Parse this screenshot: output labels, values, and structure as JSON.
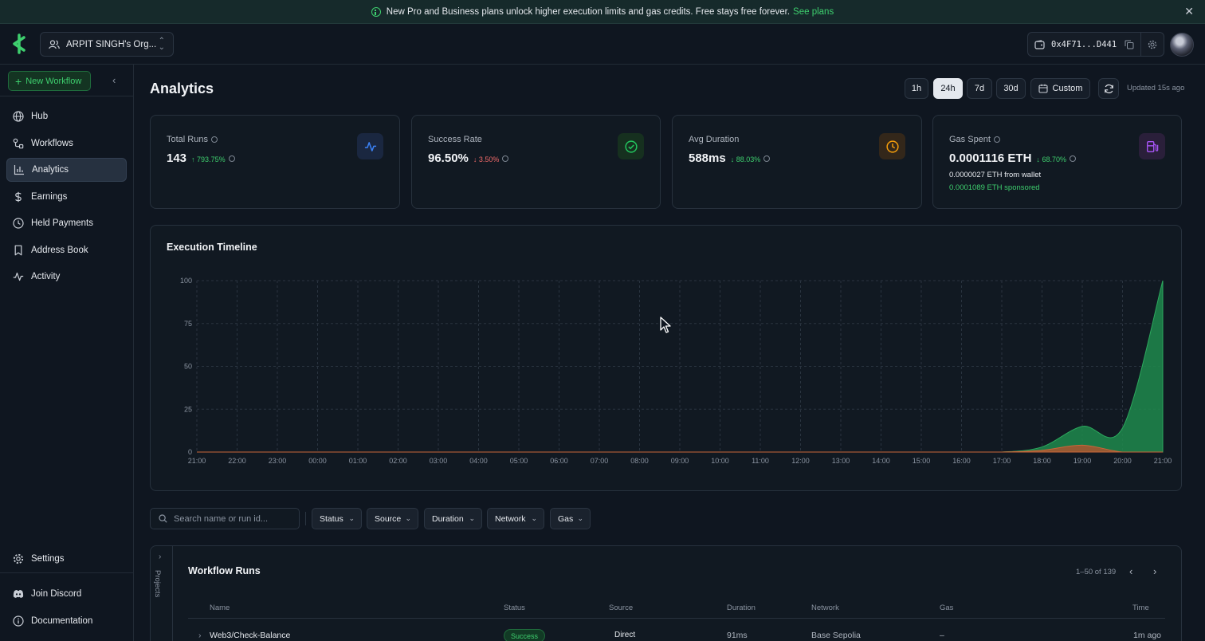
{
  "banner": {
    "message": "New Pro and Business plans unlock higher execution limits and gas credits. Free stays free forever.",
    "link": "See plans",
    "close": "✕"
  },
  "topbar": {
    "org_name": "ARPIT SINGH's Org...",
    "wallet_address": "0x4F71...D441"
  },
  "sidebar": {
    "new_workflow": "New Workflow",
    "items": [
      {
        "label": "Hub",
        "icon": "globe-icon"
      },
      {
        "label": "Workflows",
        "icon": "workflow-icon"
      },
      {
        "label": "Analytics",
        "icon": "bar-chart-icon",
        "active": true
      },
      {
        "label": "Earnings",
        "icon": "dollar-icon"
      },
      {
        "label": "Held Payments",
        "icon": "clock-icon"
      },
      {
        "label": "Address Book",
        "icon": "bookmark-icon"
      },
      {
        "label": "Activity",
        "icon": "activity-icon"
      }
    ],
    "settings": "Settings",
    "discord": "Join Discord",
    "docs": "Documentation"
  },
  "page": {
    "title": "Analytics",
    "ranges": [
      "1h",
      "24h",
      "7d",
      "30d"
    ],
    "active_range": "24h",
    "custom": "Custom",
    "updated": "Updated 15s ago"
  },
  "cards": [
    {
      "label": "Total Runs",
      "value": "143",
      "delta": "793.75%",
      "delta_dir": "up",
      "icon": "activity-icon",
      "accent": "#3b82f6"
    },
    {
      "label": "Success Rate",
      "value": "96.50%",
      "delta": "3.50%",
      "delta_dir": "down",
      "icon": "check-circle-icon",
      "accent": "#22c55e"
    },
    {
      "label": "Avg Duration",
      "value": "588ms",
      "delta": "88.03%",
      "delta_dir": "down",
      "icon": "clock-icon",
      "accent": "#f59e0b"
    },
    {
      "label": "Gas Spent",
      "value": "0.0001116 ETH",
      "delta": "68.70%",
      "delta_dir": "down",
      "icon": "fuel-icon",
      "accent": "#a855f7",
      "sub1": "0.0000027 ETH from wallet",
      "sub2": "0.0001089 ETH sponsored"
    }
  ],
  "timeline": {
    "title": "Execution Timeline"
  },
  "chart_data": {
    "type": "area",
    "x": [
      "21:00",
      "22:00",
      "23:00",
      "00:00",
      "01:00",
      "02:00",
      "03:00",
      "04:00",
      "05:00",
      "06:00",
      "07:00",
      "08:00",
      "09:00",
      "10:00",
      "11:00",
      "12:00",
      "13:00",
      "14:00",
      "15:00",
      "16:00",
      "17:00",
      "18:00",
      "19:00",
      "20:00",
      "21:00"
    ],
    "yticks": [
      0,
      25,
      50,
      75,
      100
    ],
    "ylim": [
      0,
      100
    ],
    "grid": true,
    "series": [
      {
        "color": "#1f8a4c",
        "values": [
          0,
          0,
          0,
          0,
          0,
          0,
          0,
          0,
          0,
          0,
          0,
          0,
          0,
          0,
          0,
          0,
          0,
          0,
          0,
          0,
          0,
          3,
          15,
          14,
          100
        ]
      },
      {
        "color": "#b5522e",
        "values": [
          0,
          0,
          0,
          0,
          0,
          0,
          0,
          0,
          0,
          0,
          0,
          0,
          0,
          0,
          0,
          0,
          0,
          0,
          0,
          0,
          0,
          1,
          4,
          0,
          0
        ]
      }
    ]
  },
  "filters": {
    "search_placeholder": "Search name or run id...",
    "buttons": [
      "Status",
      "Source",
      "Duration",
      "Network",
      "Gas"
    ]
  },
  "runs": {
    "rail_label": "Projects",
    "title": "Workflow Runs",
    "pagination": "1–50 of 139",
    "columns": [
      "Name",
      "Status",
      "Source",
      "Duration",
      "Network",
      "Gas",
      "Time"
    ],
    "rows": [
      {
        "name": "Web3/Check-Balance",
        "status": "Success",
        "source": "Direct",
        "duration": "91ms",
        "network": "Base Sepolia",
        "gas": "–",
        "time": "1m ago"
      }
    ]
  }
}
